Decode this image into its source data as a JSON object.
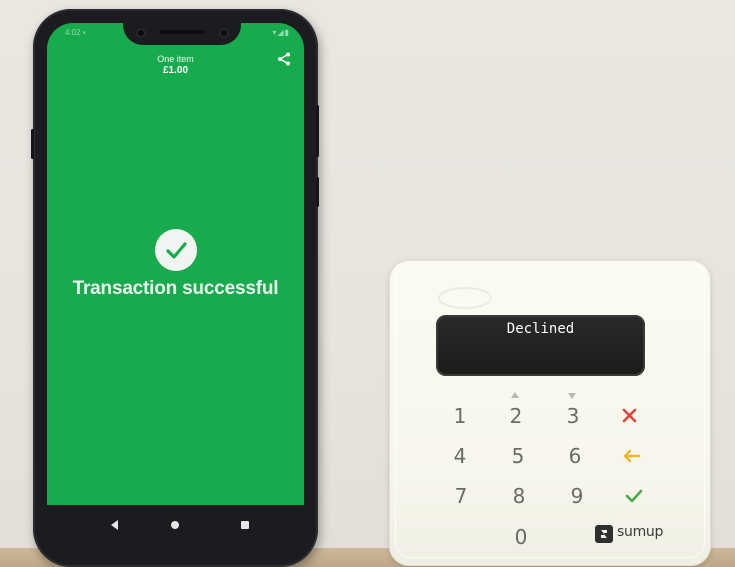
{
  "phone": {
    "header": {
      "title": "One item",
      "amount": "£1.00"
    },
    "status_text": "Transaction successful",
    "icons": [
      "share-icon",
      "check-icon",
      "back-icon",
      "home-icon",
      "recents-icon"
    ]
  },
  "reader": {
    "display": "Declined",
    "keys": [
      "1",
      "2",
      "3",
      "4",
      "5",
      "6",
      "7",
      "8",
      "9",
      "0"
    ],
    "function_keys": [
      "cancel-x-icon",
      "backspace-arrow-icon",
      "confirm-check-icon"
    ],
    "brand": "sumup"
  },
  "colors": {
    "success_green": "#18ab4e",
    "cancel_red": "#e2413b",
    "correct_yellow": "#efb52e",
    "confirm_green": "#4aa84a"
  }
}
